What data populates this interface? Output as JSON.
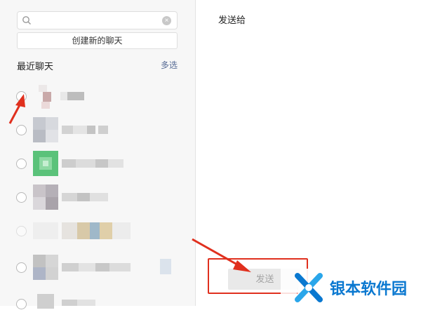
{
  "search": {
    "value": "",
    "placeholder": ""
  },
  "create_chat_label": "创建新的聊天",
  "recent_chats_title": "最近聊天",
  "multi_select_label": "多选",
  "send_to_title": "发送给",
  "send_button_label": "发送",
  "watermark": {
    "text": "银本软件园"
  },
  "colors": {
    "accent_link": "#576b95",
    "annotation_red": "#e0301e",
    "watermark_blue": "#0a78d0",
    "left_pane_bg": "#f7f7f7"
  },
  "icons": [
    "search-icon",
    "clear-icon",
    "radio-circle",
    "annotation-arrow",
    "watermark-logo-icon"
  ]
}
